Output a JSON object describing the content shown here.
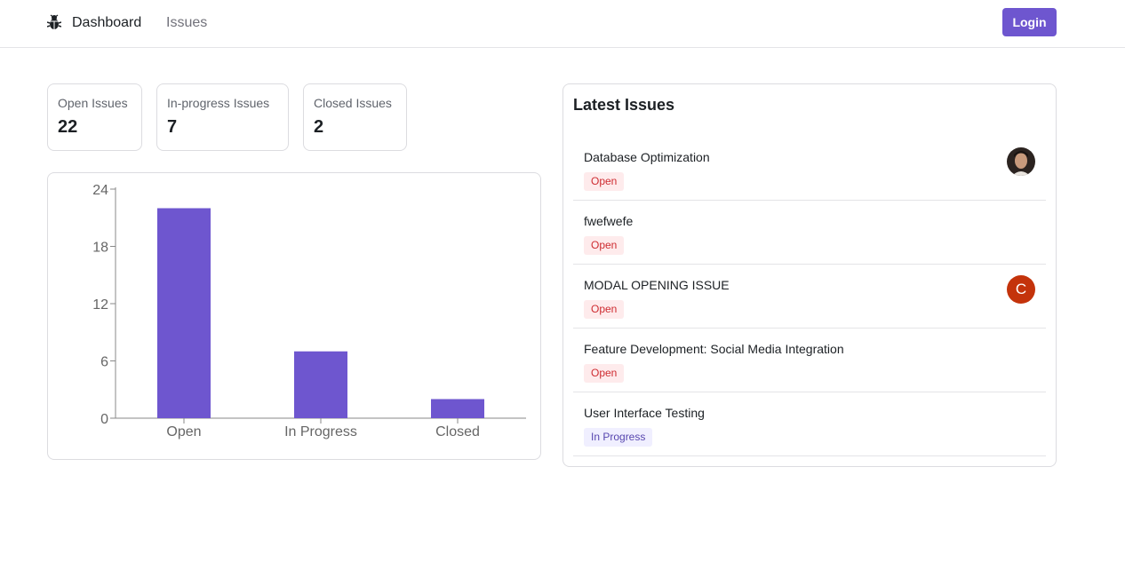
{
  "nav": {
    "logo_icon": "bug-icon",
    "dashboard_label": "Dashboard",
    "issues_label": "Issues",
    "login_label": "Login"
  },
  "stats": [
    {
      "label": "Open Issues",
      "value": "22"
    },
    {
      "label": "In-progress Issues",
      "value": "7"
    },
    {
      "label": "Closed Issues",
      "value": "2"
    }
  ],
  "chart_data": {
    "type": "bar",
    "categories": [
      "Open",
      "In Progress",
      "Closed"
    ],
    "values": [
      22,
      7,
      2
    ],
    "yticks": [
      "0",
      "6",
      "12",
      "18",
      "24"
    ],
    "ylim": [
      0,
      24
    ],
    "xlabel": "",
    "ylabel": "",
    "title": "",
    "grid": false,
    "bar_color": "#6e56cf"
  },
  "latest": {
    "title": "Latest Issues",
    "issues": [
      {
        "title": "Database Optimization",
        "status": "Open",
        "avatar": "photo"
      },
      {
        "title": "fwefwefe",
        "status": "Open",
        "avatar": ""
      },
      {
        "title": "MODAL OPENING ISSUE",
        "status": "Open",
        "avatar": "C"
      },
      {
        "title": "Feature Development: Social Media Integration",
        "status": "Open",
        "avatar": ""
      },
      {
        "title": "User Interface Testing",
        "status": "In Progress",
        "avatar": ""
      }
    ]
  },
  "colors": {
    "accent": "#6e56cf",
    "open_badge_bg": "#feebec",
    "open_badge_text": "#ce2c31",
    "progress_badge_bg": "#f0efff",
    "progress_badge_text": "#5746af",
    "avatar_letter_bg": "#c4330b"
  }
}
